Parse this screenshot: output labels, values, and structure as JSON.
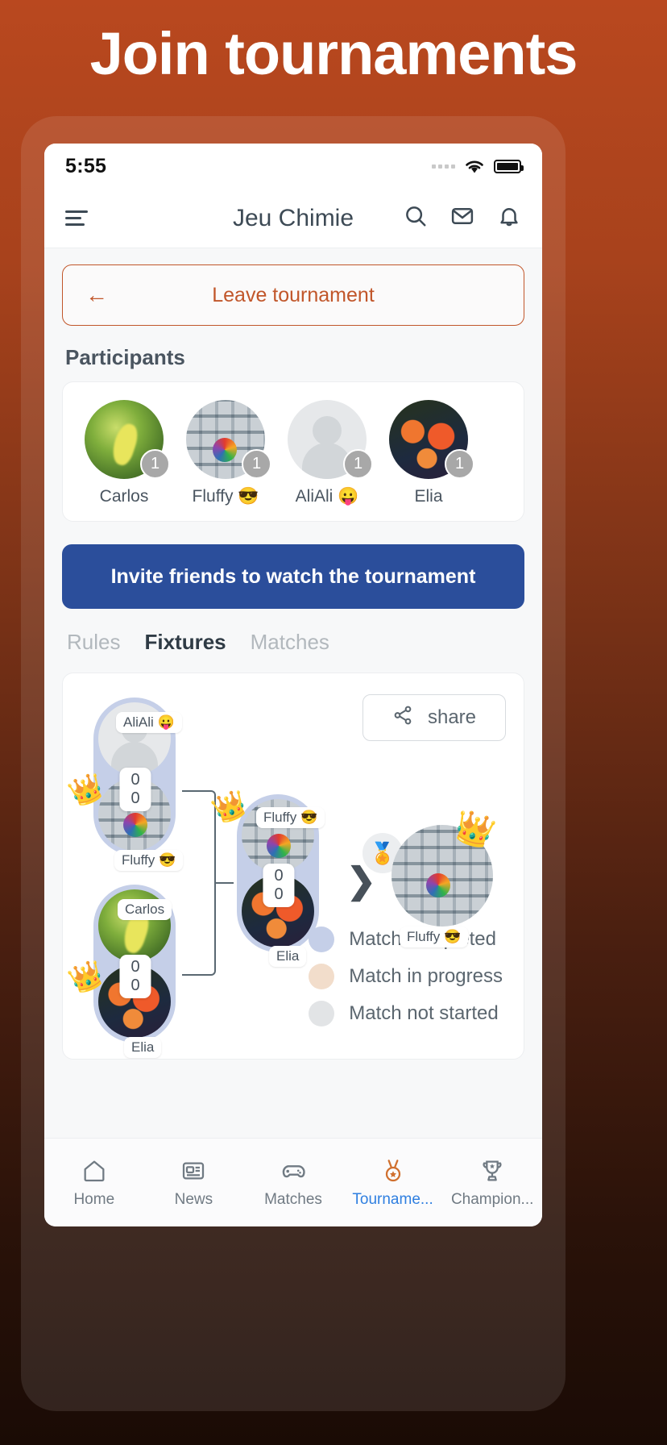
{
  "promo": {
    "headline": "Join tournaments"
  },
  "status_bar": {
    "time": "5:55",
    "signal_icon": "signal-dots-icon",
    "wifi_icon": "wifi-icon",
    "battery_icon": "battery-full-icon"
  },
  "navbar": {
    "menu_icon": "hamburger-menu-icon",
    "title": "Jeu Chimie",
    "search_icon": "search-icon",
    "mail_icon": "mail-icon",
    "bell_icon": "bell-icon"
  },
  "leave": {
    "back_icon": "arrow-left-icon",
    "label": "Leave tournament",
    "accent": "#c1562a"
  },
  "participants": {
    "title": "Participants",
    "items": [
      {
        "name": "Carlos",
        "count": "1",
        "avatar": "leaf-photo-avatar"
      },
      {
        "name": "Fluffy 😎",
        "count": "1",
        "avatar": "collage-photo-avatar"
      },
      {
        "name": "AliAli 😛",
        "count": "1",
        "avatar": "default-person-avatar"
      },
      {
        "name": "Elia",
        "count": "1",
        "avatar": "flower-photo-avatar"
      }
    ]
  },
  "invite": {
    "label": "Invite friends to watch the tournament",
    "color": "#2b4e9b"
  },
  "tabs": {
    "items": [
      {
        "label": "Rules",
        "active": false
      },
      {
        "label": "Fixtures",
        "active": true
      },
      {
        "label": "Matches",
        "active": false
      }
    ]
  },
  "bracket": {
    "share": {
      "label": "share",
      "icon": "share-nodes-icon"
    },
    "match_r1_top": {
      "player_a": "AliAli 😛",
      "player_b": "Fluffy 😎",
      "score_a": "0",
      "score_b": "0",
      "winner": "Fluffy 😎",
      "state": "completed"
    },
    "match_r1_bottom": {
      "player_a": "Carlos",
      "player_b": "Elia",
      "score_a": "0",
      "score_b": "0",
      "winner": "Elia",
      "state": "completed"
    },
    "match_final": {
      "player_a": "Fluffy 😎",
      "player_b": "Elia",
      "score_a": "0",
      "score_b": "0",
      "winner": "Fluffy 😎",
      "state": "completed"
    },
    "champion": {
      "name": "Fluffy 😎",
      "medal_icon": "medal-icon",
      "crown_icon": "crown-icon"
    },
    "next_arrow_icon": "chevron-right-icon",
    "legend": [
      {
        "label": "Match completed",
        "color": "#c5cfe8"
      },
      {
        "label": "Match in progress",
        "color": "#f2ddcb"
      },
      {
        "label": "Match not started",
        "color": "#e2e4e6"
      }
    ]
  },
  "tabbar": {
    "items": [
      {
        "label": "Home",
        "icon": "home-icon",
        "active": false
      },
      {
        "label": "News",
        "icon": "news-icon",
        "active": false
      },
      {
        "label": "Matches",
        "icon": "gamepad-icon",
        "active": false
      },
      {
        "label": "Tourname...",
        "icon": "medal-icon",
        "active": true
      },
      {
        "label": "Champion...",
        "icon": "trophy-icon",
        "active": false
      }
    ],
    "active_color": "#2f7fe0"
  }
}
